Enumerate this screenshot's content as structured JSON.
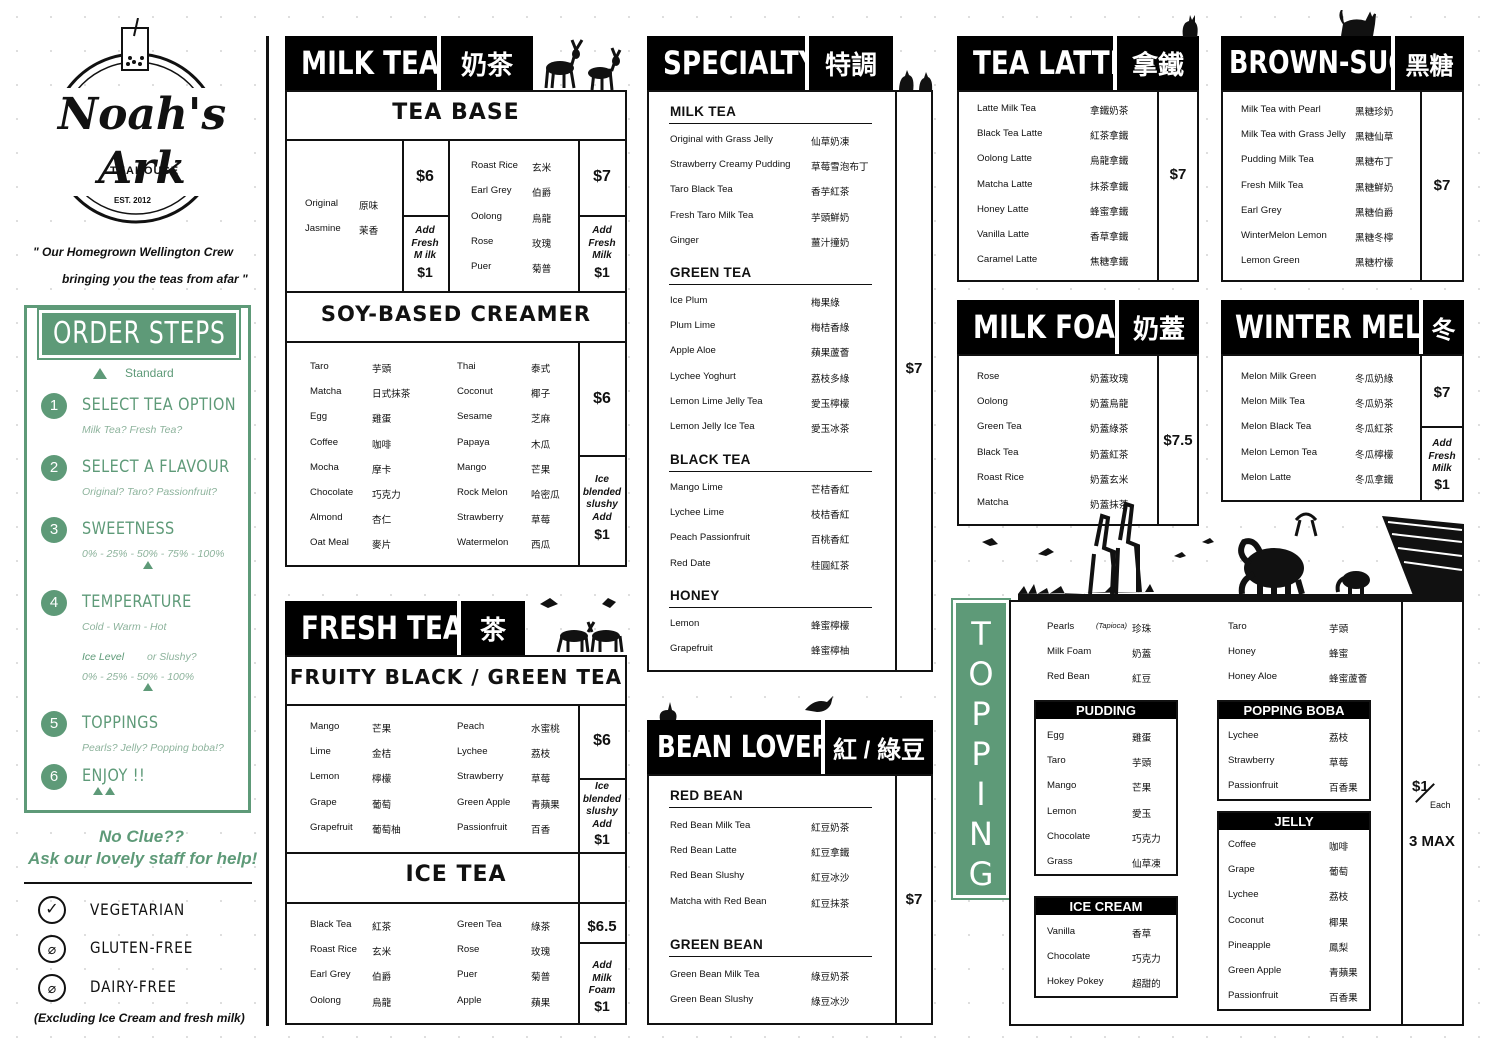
{
  "brand": {
    "name": "Noah's Ark",
    "tag": "TEAHOUSE",
    "est": "EST. 2012",
    "quote1": "\" Our Homegrown Wellington Crew",
    "quote2": "bringing you the teas from afar \""
  },
  "steps": {
    "title": "ORDER STEPS",
    "standard": "Standard",
    "items": [
      {
        "n": "1",
        "title": "SELECT TEA OPTION",
        "sub": "Milk Tea?   Fresh Tea?"
      },
      {
        "n": "2",
        "title": "SELECT A FLAVOUR",
        "sub": "Original?  Taro?  Passionfruit?"
      },
      {
        "n": "3",
        "title": "SWEETNESS",
        "sub": "0% - 25% - 50% - 75% - 100%"
      },
      {
        "n": "4",
        "title": "TEMPERATURE",
        "sub": "Cold - Warm - Hot",
        "sub2a": "Ice Level",
        "sub2b": "or Slushy?",
        "sub3": "0% - 25% - 50% - 100%"
      },
      {
        "n": "5",
        "title": "TOPPINGS",
        "sub": "Pearls?   Jelly?  Popping boba!?"
      },
      {
        "n": "6",
        "title": "ENJOY !!",
        "sub": ""
      }
    ]
  },
  "noclue": {
    "l1": "No Clue??",
    "l2": "Ask our lovely staff for help!"
  },
  "diet": {
    "veg": "VEGETARIAN",
    "gf": "GLUTEN-FREE",
    "df": "DAIRY-FREE",
    "note": "(Excluding Ice Cream and fresh milk)"
  },
  "milk_tea": {
    "en": "MILK TEA",
    "zh": "奶茶",
    "base": "TEA BASE",
    "base_a": [
      {
        "en": "Original",
        "zh": "原味"
      },
      {
        "en": "Jasmine",
        "zh": "茉香"
      }
    ],
    "price_a": "$6",
    "base_b": [
      {
        "en": "Roast Rice",
        "zh": "玄米"
      },
      {
        "en": "Earl Grey",
        "zh": "伯爵"
      },
      {
        "en": "Oolong",
        "zh": "烏龍"
      },
      {
        "en": "Rose",
        "zh": "玫瑰"
      },
      {
        "en": "Puer",
        "zh": "菊普"
      }
    ],
    "price_b": "$7",
    "add_a1": "Add",
    "add_a2": "Fresh",
    "add_a3": "M ilk",
    "add_a_price": "$1",
    "add_b1": "Add",
    "add_b2": "Fresh",
    "add_b3": "Milk",
    "add_b_price": "$1",
    "soy": "SOY-BASED CREAMER",
    "soy_a": [
      {
        "en": "Taro",
        "zh": "芋頭"
      },
      {
        "en": "Matcha",
        "zh": "日式抹茶"
      },
      {
        "en": "Egg",
        "zh": "雞蛋"
      },
      {
        "en": "Coffee",
        "zh": "咖啡"
      },
      {
        "en": "Mocha",
        "zh": "摩卡"
      },
      {
        "en": "Chocolate",
        "zh": "巧克力"
      },
      {
        "en": "Almond",
        "zh": "杏仁"
      },
      {
        "en": "Oat Meal",
        "zh": "麥片"
      }
    ],
    "soy_b": [
      {
        "en": "Thai",
        "zh": "泰式"
      },
      {
        "en": "Coconut",
        "zh": "椰子"
      },
      {
        "en": "Sesame",
        "zh": "芝麻"
      },
      {
        "en": "Papaya",
        "zh": "木瓜"
      },
      {
        "en": "Mango",
        "zh": "芒果"
      },
      {
        "en": "Rock Melon",
        "zh": "哈密瓜"
      },
      {
        "en": "Strawberry",
        "zh": "草莓"
      },
      {
        "en": "Watermelon",
        "zh": "西瓜"
      }
    ],
    "soy_price": "$6",
    "soy_n1": "Ice",
    "soy_n2": "blended",
    "soy_n3": "slushy",
    "soy_n4": "Add",
    "soy_n_price": "$1"
  },
  "fresh_tea": {
    "en": "FRESH TEA",
    "zh": "茶",
    "fruity": "FRUITY BLACK / GREEN TEA",
    "a": [
      {
        "en": "Mango",
        "zh": "芒果"
      },
      {
        "en": "Lime",
        "zh": "金桔"
      },
      {
        "en": "Lemon",
        "zh": "檸檬"
      },
      {
        "en": "Grape",
        "zh": "葡萄"
      },
      {
        "en": "Grapefruit",
        "zh": "葡萄柚"
      }
    ],
    "b": [
      {
        "en": "Peach",
        "zh": "水蜜桃"
      },
      {
        "en": "Lychee",
        "zh": "荔枝"
      },
      {
        "en": "Strawberry",
        "zh": "草莓"
      },
      {
        "en": "Green Apple",
        "zh": "青蘋果"
      },
      {
        "en": "Passionfruit",
        "zh": "百香"
      }
    ],
    "price": "$6",
    "n1": "Ice",
    "n2": "blended",
    "n3": "slushy",
    "n4": "Add",
    "n_price": "$1",
    "ice": "ICE TEA",
    "ia": [
      {
        "en": "Black Tea",
        "zh": "紅茶"
      },
      {
        "en": "Roast Rice",
        "zh": "玄米"
      },
      {
        "en": "Earl Grey",
        "zh": "伯爵"
      },
      {
        "en": "Oolong",
        "zh": "烏龍"
      }
    ],
    "ib": [
      {
        "en": "Green Tea",
        "zh": "綠茶"
      },
      {
        "en": "Rose",
        "zh": "玫瑰"
      },
      {
        "en": "Puer",
        "zh": "菊普"
      },
      {
        "en": "Apple",
        "zh": "蘋果"
      }
    ],
    "ice_price": "$6.5",
    "in1": "Add",
    "in2": "Milk",
    "in3": "Foam",
    "in_price": "$1"
  },
  "specialty": {
    "en": "SPECIALTY",
    "zh": "特調",
    "price": "$7",
    "milk": "MILK TEA",
    "milk_items": [
      {
        "en": "Original with Grass Jelly",
        "zh": "仙草奶凍"
      },
      {
        "en": "Strawberry Creamy Pudding",
        "zh": "草莓雪泡布丁"
      },
      {
        "en": "Taro Black Tea",
        "zh": "香芋紅茶"
      },
      {
        "en": "Fresh Taro Milk Tea",
        "zh": "芋頭鮮奶"
      },
      {
        "en": "Ginger",
        "zh": "薑汁撞奶"
      }
    ],
    "green": "GREEN TEA",
    "green_items": [
      {
        "en": "Ice Plum",
        "zh": "梅果綠"
      },
      {
        "en": "Plum Lime",
        "zh": "梅桔香綠"
      },
      {
        "en": "Apple Aloe",
        "zh": "蘋果蘆薈"
      },
      {
        "en": "Lychee Yoghurt",
        "zh": "荔枝多綠"
      },
      {
        "en": "Lemon Lime Jelly Tea",
        "zh": "愛玉檸檬"
      },
      {
        "en": "Lemon Jelly Ice Tea",
        "zh": "愛玉冰茶"
      }
    ],
    "black": "BLACK TEA",
    "black_items": [
      {
        "en": "Mango Lime",
        "zh": "芒桔香紅"
      },
      {
        "en": "Lychee Lime",
        "zh": "枝桔香紅"
      },
      {
        "en": "Peach Passionfruit",
        "zh": "百桃香紅"
      },
      {
        "en": "Red Date",
        "zh": "桂圓紅茶"
      }
    ],
    "honey": "HONEY",
    "honey_items": [
      {
        "en": "Lemon",
        "zh": "蜂蜜檸檬"
      },
      {
        "en": "Grapefruit",
        "zh": "蜂蜜檸柚"
      }
    ]
  },
  "bean": {
    "en": "BEAN LOVERS",
    "zh": "紅 / 綠豆",
    "price": "$7",
    "red": "RED BEAN",
    "red_items": [
      {
        "en": "Red Bean Milk Tea",
        "zh": "紅豆奶茶"
      },
      {
        "en": "Red Bean Latte",
        "zh": "紅豆拿鐵"
      },
      {
        "en": "Red Bean Slushy",
        "zh": "紅豆冰沙"
      },
      {
        "en": "Matcha with Red Bean",
        "zh": "紅豆抹茶"
      }
    ],
    "green": "GREEN BEAN",
    "green_items": [
      {
        "en": "Green Bean Milk Tea",
        "zh": "綠豆奶茶"
      },
      {
        "en": "Green Bean Slushy",
        "zh": "綠豆冰沙"
      }
    ]
  },
  "latte": {
    "en": "TEA LATTE",
    "zh": "拿鐵",
    "price": "$7",
    "items": [
      {
        "en": "Latte Milk Tea",
        "zh": "拿鐵奶茶"
      },
      {
        "en": "Black Tea Latte",
        "zh": "紅茶拿鐵"
      },
      {
        "en": "Oolong Latte",
        "zh": "烏龍拿鐵"
      },
      {
        "en": "Matcha Latte",
        "zh": "抹茶拿鐵"
      },
      {
        "en": "Honey Latte",
        "zh": "蜂蜜拿鐵"
      },
      {
        "en": "Vanilla Latte",
        "zh": "香草拿鐵"
      },
      {
        "en": "Caramel Latte",
        "zh": "焦糖拿鐵"
      }
    ]
  },
  "brown": {
    "en": "BROWN-SUGAR",
    "zh": "黑糖",
    "price": "$7",
    "items": [
      {
        "en": "Milk Tea with Pearl",
        "zh": "黑糖珍奶"
      },
      {
        "en": "Milk Tea with Grass Jelly",
        "zh": "黑糖仙草"
      },
      {
        "en": "Pudding Milk Tea",
        "zh": "黑糖布丁"
      },
      {
        "en": "Fresh Milk Tea",
        "zh": "黑糖鮮奶"
      },
      {
        "en": "Earl Grey",
        "zh": "黑糖伯爵"
      },
      {
        "en": "WinterMelon Lemon",
        "zh": "黑糖冬檸"
      },
      {
        "en": "Lemon Green",
        "zh": "黑糖柠檬"
      }
    ]
  },
  "foam": {
    "en": "MILK FOAM",
    "zh": "奶蓋",
    "price": "$7.5",
    "items": [
      {
        "en": "Rose",
        "zh": "奶蓋玫瑰"
      },
      {
        "en": "Oolong",
        "zh": "奶蓋烏龍"
      },
      {
        "en": "Green Tea",
        "zh": "奶蓋綠茶"
      },
      {
        "en": "Black Tea",
        "zh": "奶蓋紅茶"
      },
      {
        "en": "Roast Rice",
        "zh": "奶蓋玄米"
      },
      {
        "en": "Matcha",
        "zh": "奶蓋抹茶"
      }
    ]
  },
  "melon": {
    "en": "WINTER MELON",
    "zh": "冬",
    "price": "$7",
    "items": [
      {
        "en": "Melon Milk Green",
        "zh": "冬瓜奶綠"
      },
      {
        "en": "Melon Milk Tea",
        "zh": "冬瓜奶茶"
      },
      {
        "en": "Melon Black Tea",
        "zh": "冬瓜紅茶"
      },
      {
        "en": "Melon Lemon Tea",
        "zh": "冬瓜檸檬"
      },
      {
        "en": "Melon Latte",
        "zh": "冬瓜拿鐵"
      }
    ],
    "n1": "Add",
    "n2": "Fresh",
    "n3": "Milk",
    "n_price": "$1"
  },
  "topping": {
    "title": "T O P P I N G",
    "price": "$1",
    "each": "Each",
    "max": "3 MAX",
    "ta": [
      {
        "en": "Pearls",
        "tag": "(Tapioca)",
        "zh": "珍珠"
      },
      {
        "en": "Milk Foam",
        "zh": "奶蓋"
      },
      {
        "en": "Red Bean",
        "zh": "紅豆"
      }
    ],
    "tb": [
      {
        "en": "Taro",
        "zh": "芋頭"
      },
      {
        "en": "Honey",
        "zh": "蜂蜜"
      },
      {
        "en": "Honey Aloe",
        "zh": "蜂蜜蘆薈"
      }
    ],
    "pudding": "PUDDING",
    "pudding_items": [
      {
        "en": "Egg",
        "zh": "雞蛋"
      },
      {
        "en": "Taro",
        "zh": "芋頭"
      },
      {
        "en": "Mango",
        "zh": "芒果"
      },
      {
        "en": "Lemon",
        "zh": "愛玉"
      },
      {
        "en": "Chocolate",
        "zh": "巧克力"
      },
      {
        "en": "Grass",
        "zh": "仙草凍"
      }
    ],
    "icecream": "ICE CREAM",
    "icecream_items": [
      {
        "en": "Vanilla",
        "zh": "香草"
      },
      {
        "en": "Chocolate",
        "zh": "巧克力"
      },
      {
        "en": "Hokey Pokey",
        "zh": "超甜的"
      }
    ],
    "boba": "POPPING BOBA",
    "boba_items": [
      {
        "en": "Lychee",
        "zh": "荔枝"
      },
      {
        "en": "Strawberry",
        "zh": "草莓"
      },
      {
        "en": "Passionfruit",
        "zh": "百香果"
      }
    ],
    "jelly": "JELLY",
    "jelly_items": [
      {
        "en": "Coffee",
        "zh": "咖啡"
      },
      {
        "en": "Grape",
        "zh": "葡萄"
      },
      {
        "en": "Lychee",
        "zh": "荔枝"
      },
      {
        "en": "Coconut",
        "zh": "椰果"
      },
      {
        "en": "Pineapple",
        "zh": "鳳梨"
      },
      {
        "en": "Green Apple",
        "zh": "青蘋果"
      },
      {
        "en": "Passionfruit",
        "zh": "百香果"
      }
    ]
  },
  "colors": {
    "accent": "#5e9a78",
    "ink": "#111111"
  }
}
